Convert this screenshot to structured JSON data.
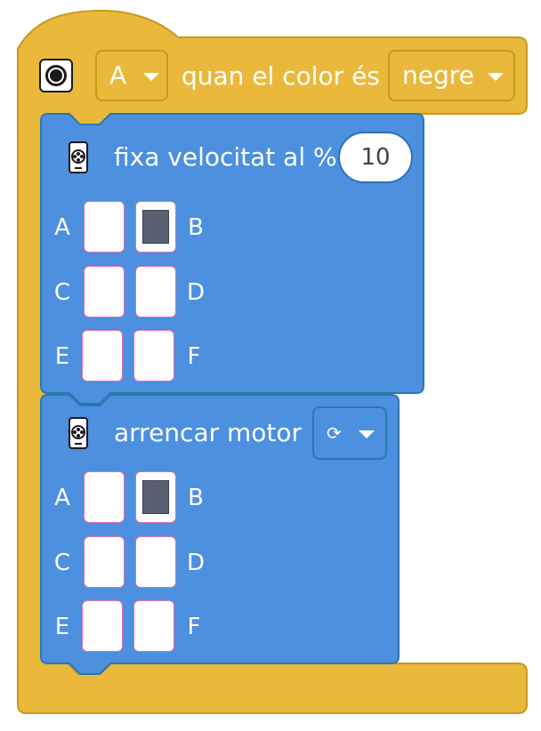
{
  "hat_block": {
    "port": "A",
    "condition_text": "quan el color és",
    "color": "negre",
    "icon": "color-sensor-icon"
  },
  "set_speed_block": {
    "label": "fixa velocitat al %",
    "speed_value": "10",
    "icon": "motor-icon",
    "ports": [
      {
        "letter": "A",
        "selected": false
      },
      {
        "letter": "B",
        "selected": true
      },
      {
        "letter": "C",
        "selected": false
      },
      {
        "letter": "D",
        "selected": false
      },
      {
        "letter": "E",
        "selected": false
      },
      {
        "letter": "F",
        "selected": false
      }
    ]
  },
  "start_motor_block": {
    "label": "arrencar motor",
    "direction_glyph": "⟳",
    "direction_icon": "rotate-clockwise-icon",
    "icon": "motor-icon",
    "ports": [
      {
        "letter": "A",
        "selected": false
      },
      {
        "letter": "B",
        "selected": true
      },
      {
        "letter": "C",
        "selected": false
      },
      {
        "letter": "D",
        "selected": false
      },
      {
        "letter": "E",
        "selected": false
      },
      {
        "letter": "F",
        "selected": false
      }
    ]
  },
  "colors": {
    "event_block": "#eab93c",
    "event_border": "#c79a1c",
    "motor_block": "#4c90df",
    "motor_border": "#2b78ae",
    "port_selected": "#5b5f72"
  }
}
